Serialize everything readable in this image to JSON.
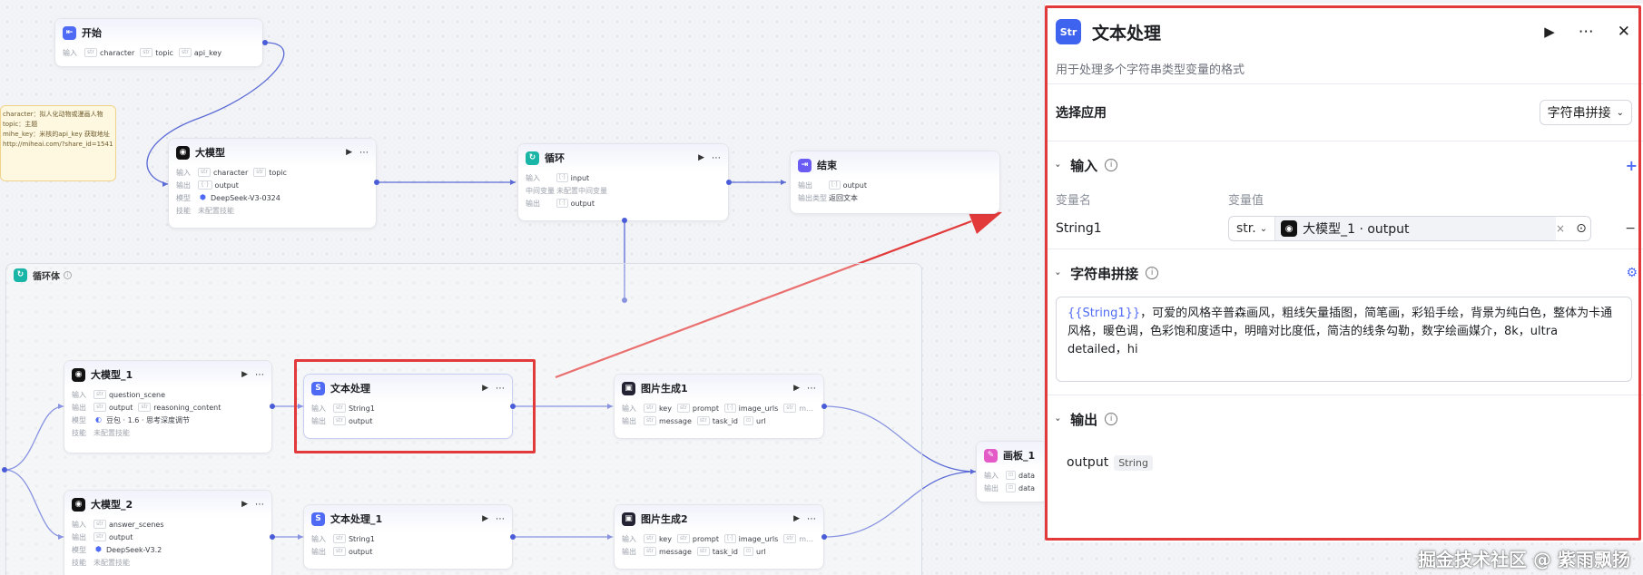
{
  "note": {
    "lines": [
      "character：拟人化动物或漫画人物",
      "topic：主题",
      "mihe_key：米核的api_key 获取地址",
      "http://miheai.com/?share_id=15412"
    ]
  },
  "nodes": {
    "start": {
      "title": "开始",
      "input_label": "输入",
      "inputs": [
        "character",
        "topic",
        "api_key"
      ]
    },
    "llm": {
      "title": "大模型",
      "input_label": "输入",
      "inputs": [
        "character",
        "topic"
      ],
      "output_label": "输出",
      "outputs": [
        "output"
      ],
      "model_label": "模型",
      "model": "DeepSeek-V3-0324",
      "skill_label": "技能",
      "skill": "未配置技能"
    },
    "loop": {
      "title": "循环",
      "input_label": "输入",
      "inputs": [
        "input"
      ],
      "mid_label": "中间变量",
      "mid": "未配置中间变量",
      "output_label": "输出",
      "outputs": [
        "output"
      ]
    },
    "end": {
      "title": "结束",
      "output_label": "输出",
      "outputs": [
        "output"
      ],
      "type_label": "输出类型",
      "type": "返回文本"
    },
    "llm1": {
      "title": "大模型_1",
      "input_label": "输入",
      "inputs": [
        "question_scene"
      ],
      "output_label": "输出",
      "outputs": [
        "output",
        "reasoning_content"
      ],
      "model_label": "模型",
      "model": "豆包 · 1.6 · 思考深度调节",
      "skill_label": "技能",
      "skill": "未配置技能"
    },
    "text": {
      "title": "文本处理",
      "input_label": "输入",
      "inputs": [
        "String1"
      ],
      "output_label": "输出",
      "outputs": [
        "output"
      ]
    },
    "img1": {
      "title": "图片生成1",
      "input_label": "输入",
      "inputs": [
        "key",
        "prompt",
        "image_urls",
        "m..."
      ],
      "output_label": "输出",
      "outputs": [
        "message",
        "task_id",
        "url"
      ]
    },
    "canvas": {
      "title": "画板_1",
      "input_label": "输入",
      "inputs": [
        "data"
      ],
      "output_label": "输出",
      "outputs": [
        "data"
      ]
    },
    "llm2": {
      "title": "大模型_2",
      "input_label": "输入",
      "inputs": [
        "answer_scenes"
      ],
      "output_label": "输出",
      "outputs": [
        "output"
      ],
      "model_label": "模型",
      "model": "DeepSeek-V3.2",
      "skill_label": "技能",
      "skill": "未配置技能"
    },
    "text1": {
      "title": "文本处理_1",
      "input_label": "输入",
      "inputs": [
        "String1"
      ],
      "output_label": "输出",
      "outputs": [
        "output"
      ]
    },
    "img2": {
      "title": "图片生成2",
      "input_label": "输入",
      "inputs": [
        "key",
        "prompt",
        "image_urls",
        "m..."
      ],
      "output_label": "输出",
      "outputs": [
        "message",
        "task_id",
        "url"
      ]
    }
  },
  "loop_body": {
    "title": "循环体"
  },
  "panel": {
    "title": "文本处理",
    "description": "用于处理多个字符串类型变量的格式",
    "select_app_label": "选择应用",
    "select_app_value": "字符串拼接",
    "input_section": "输入",
    "col_name": "变量名",
    "col_value": "变量值",
    "var_name": "String1",
    "var_type": "str.",
    "var_ref": "大模型_1 · output",
    "concat_section": "字符串拼接",
    "template_var": "{{String1}}",
    "template_text": "，可爱的风格辛普森画风，粗线矢量插图，简笔画，彩铅手绘，背景为纯白色，整体为卡通风格，暖色调，色彩饱和度适中，明暗对比度低，简洁的线条勾勒，数字绘画媒介，8k，ultra detailed，hi",
    "output_section": "输出",
    "output_name": "output",
    "output_type": "String"
  },
  "watermark": "掘金技术社区 @ 紫雨飘扬",
  "colors": {
    "accent": "#4f6bf5",
    "highlight": "#e23a3a",
    "wire": "#5a6ad6"
  }
}
